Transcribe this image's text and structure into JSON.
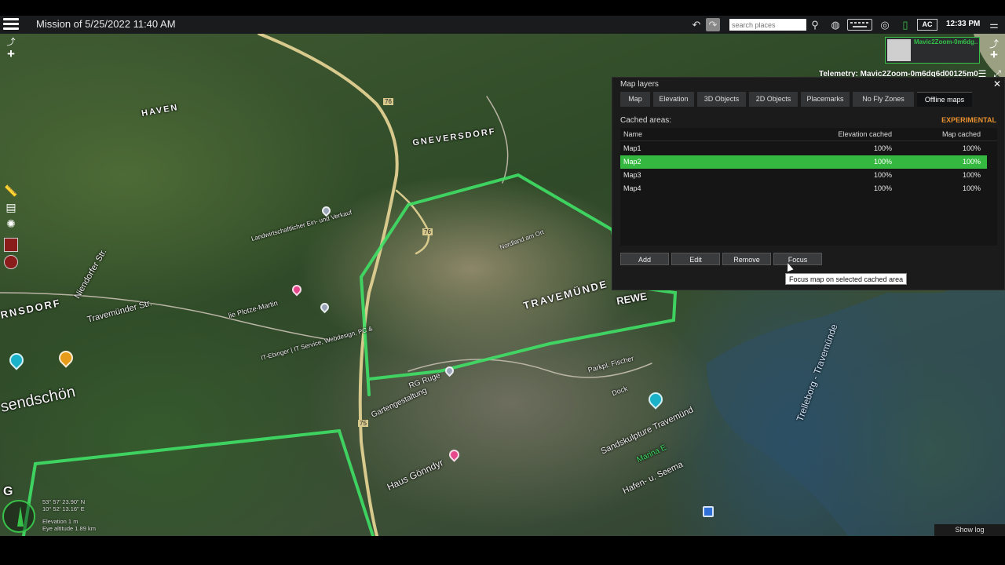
{
  "header": {
    "title": "Mission of 5/25/2022 11:40 AM",
    "search_placeholder": "search places",
    "ac_label": "AC",
    "time": "12:33 PM"
  },
  "drone": {
    "name": "Mavic2Zoom-0m6dg..",
    "telemetry": "Telemetry: Mavic2Zoom-0m6dq6d00125m0"
  },
  "panel": {
    "title": "Map layers",
    "tabs": [
      {
        "label": "Map"
      },
      {
        "label": "Elevation"
      },
      {
        "label": "3D Objects"
      },
      {
        "label": "2D Objects"
      },
      {
        "label": "Placemarks"
      },
      {
        "label": "No Fly Zones"
      },
      {
        "label": "Offline maps"
      }
    ],
    "active_tab": "Offline maps",
    "cached_label": "Cached areas:",
    "experimental": "EXPERIMENTAL",
    "columns": [
      "Name",
      "Elevation cached",
      "Map cached"
    ],
    "rows": [
      {
        "name": "Map1",
        "elevation": "100%",
        "map": "100%"
      },
      {
        "name": "Map2",
        "elevation": "100%",
        "map": "100%"
      },
      {
        "name": "Map3",
        "elevation": "100%",
        "map": "100%"
      },
      {
        "name": "Map4",
        "elevation": "100%",
        "map": "100%"
      }
    ],
    "selected_row": "Map2",
    "buttons": {
      "add": "Add",
      "edit": "Edit",
      "remove": "Remove",
      "focus": "Focus"
    },
    "tooltip": "Focus map on selected cached area"
  },
  "map_labels": {
    "haven": "HAVEN",
    "gneversdorf": "GNEVERSDORF",
    "niendorfer": "Niendorfer Str.",
    "travemunder_str": "Travemünder Str.",
    "rnsdorf": "RNSDORF",
    "landwirt": "Landwirtschaftlicher Ein- und Verkauf",
    "plotze": "lie Plotze-Martin",
    "it_ebinger": "IT-Ebinger | IT Service, Webdesign, PC &",
    "sendschon": "sendschön",
    "nordland": "Nordland am Ort",
    "travemunde": "TRAVEMÜNDE",
    "rewe": "REWE",
    "rg_ruge": "RG Ruge",
    "gartengestaltung": "Gartengestaltung",
    "parkpl": "Parkpl. Fischer",
    "haus_gonndyr": "Haus Gönndyr",
    "sandskulpture": "Sandskulpture Travemünd",
    "marina": "Marina E",
    "hafen": "Hafen- u. Seema",
    "trelleborg": "Trelleborg - Travemünde",
    "dock": "Dock",
    "road_76a": "76",
    "road_76b": "76",
    "road_75": "75",
    "g": "G"
  },
  "status": {
    "lat": "53° 57' 23.90\" N",
    "lon": "10° 52' 13.16\" E",
    "elevation": "Elevation 1 m",
    "eye_altitude": "Eye altitude 1.89 km",
    "show_log": "Show log"
  },
  "colors": {
    "accent_green": "#35b83f",
    "route_green": "#3fe066",
    "experimental_orange": "#e8912f"
  }
}
